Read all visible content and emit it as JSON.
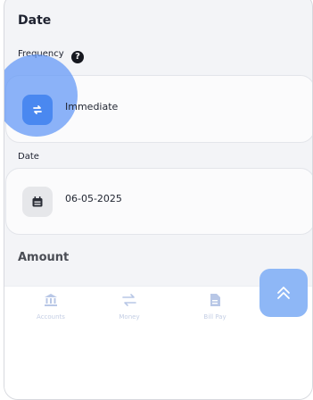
{
  "section": {
    "title": "Date"
  },
  "frequency": {
    "label": "Frequency",
    "help_icon": "question-circle-icon",
    "value": "Immediate",
    "icon": "repeat-icon",
    "accent": "#4a88f0"
  },
  "date": {
    "label": "Date",
    "value": "06-05-2025",
    "icon": "calendar-icon"
  },
  "amount": {
    "title": "Amount"
  },
  "bottom_nav": [
    {
      "label": "Accounts",
      "icon": "bank-icon"
    },
    {
      "label": "Money",
      "icon": "transfer-arrows-icon"
    },
    {
      "label": "Bill Pay",
      "icon": "bill-icon"
    }
  ],
  "scroll_top": {
    "icon": "double-chevron-up-icon",
    "color": "#8eb7f6"
  }
}
